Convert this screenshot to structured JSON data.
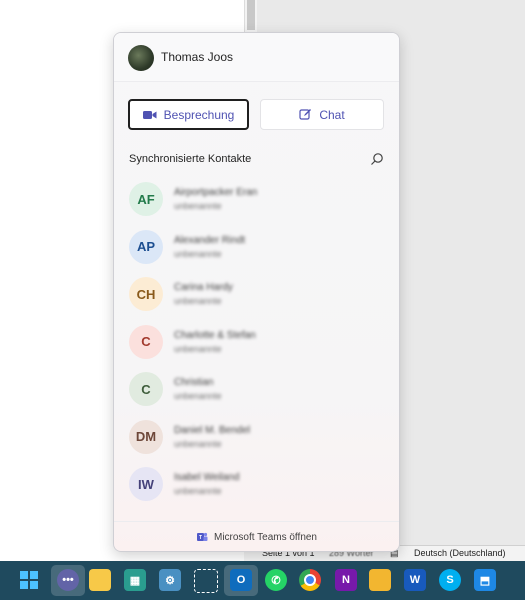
{
  "flyout": {
    "user_name": "Thomas Joos",
    "meeting_button": "Besprechung",
    "chat_button": "Chat",
    "section_title": "Synchronisierte Kontakte",
    "footer_label": "Microsoft Teams öffnen",
    "contacts": [
      {
        "initials": "AF",
        "name": "Airportpacker Eran",
        "detail": "unbenannte",
        "color": "#dff1e6",
        "text_color": "#237b4b"
      },
      {
        "initials": "AP",
        "name": "Alexander Rindt",
        "detail": "unbenannte",
        "color": "#dbe7f7",
        "text_color": "#1d4f91"
      },
      {
        "initials": "CH",
        "name": "Carina Hardy",
        "detail": "unbenannte",
        "color": "#fcecd4",
        "text_color": "#8a5a1b"
      },
      {
        "initials": "C",
        "name": "Charlotte & Stefan",
        "detail": "unbenannte",
        "color": "#fbe0dd",
        "text_color": "#a23a2e"
      },
      {
        "initials": "C",
        "name": "Christian",
        "detail": "unbenannte",
        "color": "#e1ebe0",
        "text_color": "#3f5e3c"
      },
      {
        "initials": "DM",
        "name": "Daniel M. Bendel",
        "detail": "unbenannte",
        "color": "#efe2dc",
        "text_color": "#6d4638"
      },
      {
        "initials": "IW",
        "name": "Isabel Weiland",
        "detail": "unbenannte",
        "color": "#e6e5f4",
        "text_color": "#45427a"
      }
    ]
  },
  "statusbar": {
    "page": "Seite 1 von 1",
    "words": "289 Wörter",
    "language": "Deutsch (Deutschland)"
  },
  "taskbar": {
    "icons": [
      "windows-start-icon",
      "teams-chat-icon",
      "file-explorer-icon",
      "app-icon",
      "app-icon-2",
      "snipping-icon",
      "outlook-icon",
      "whatsapp-icon",
      "chrome-icon",
      "onenote-icon",
      "folder-icon",
      "word-icon",
      "skype-icon",
      "app-icon-3"
    ]
  }
}
